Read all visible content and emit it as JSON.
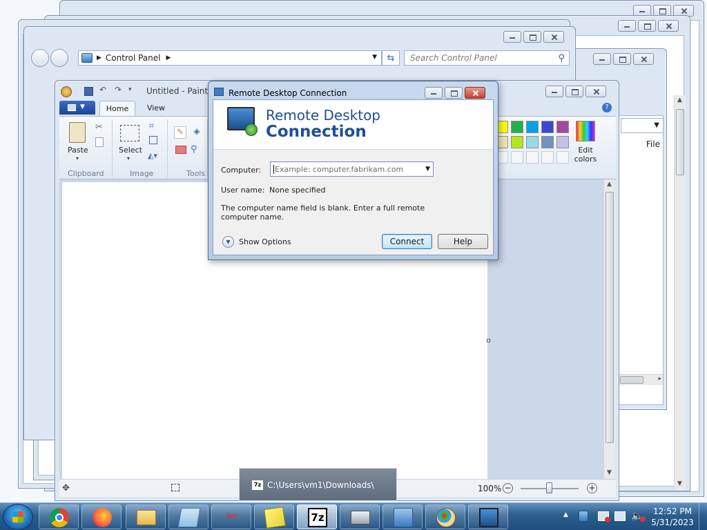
{
  "control_panel": {
    "breadcrumb": "Control Panel",
    "search_placeholder": "Search Control Panel"
  },
  "paint": {
    "title": "Untitled - Paint",
    "tabs": [
      "Home",
      "View"
    ],
    "tools": {
      "paste": "Paste",
      "select": "Select",
      "edit_colors": "Edit colors"
    },
    "groups": [
      "Clipboard",
      "Image",
      "Tools"
    ],
    "zoom": "100%",
    "palette_row1": [
      "#ffff00",
      "#22b14c",
      "#00a2e8",
      "#3f48cc",
      "#a349a4"
    ],
    "palette_row2": [
      "#efe4b0",
      "#b5e61d",
      "#99d9ea",
      "#7092be",
      "#c8bfe7"
    ]
  },
  "file_explorer_partial": {
    "column_header": "File"
  },
  "rdp": {
    "window_title": "Remote Desktop Connection",
    "banner_line1": "Remote Desktop",
    "banner_line2": "Connection",
    "computer_label": "Computer:",
    "computer_placeholder": "Example: computer.fabrikam.com",
    "username_label": "User name:",
    "username_value": "None specified",
    "message": "The computer name field is blank. Enter a full remote computer name.",
    "show_options": "Show Options",
    "connect": "Connect",
    "help": "Help"
  },
  "jump_preview": {
    "title": "C:\\Users\\vm1\\Downloads\\"
  },
  "taskbar": {
    "time": "12:52 PM",
    "date": "5/31/2023",
    "apps": [
      {
        "icon": "chrome-icon"
      },
      {
        "icon": "firefox-icon"
      },
      {
        "icon": "file-explorer-icon"
      },
      {
        "icon": "notepad-icon"
      },
      {
        "icon": "snipping-tool-icon"
      },
      {
        "icon": "sticky-notes-icon"
      },
      {
        "icon": "7zip-icon",
        "active": true
      },
      {
        "icon": "fax-scan-icon"
      },
      {
        "icon": "control-panel-icon"
      },
      {
        "icon": "paint-icon"
      },
      {
        "icon": "remote-desktop-icon"
      }
    ]
  },
  "colors": {
    "accent": "#1d4597",
    "rdp_title_blue": "#1f4e96"
  }
}
